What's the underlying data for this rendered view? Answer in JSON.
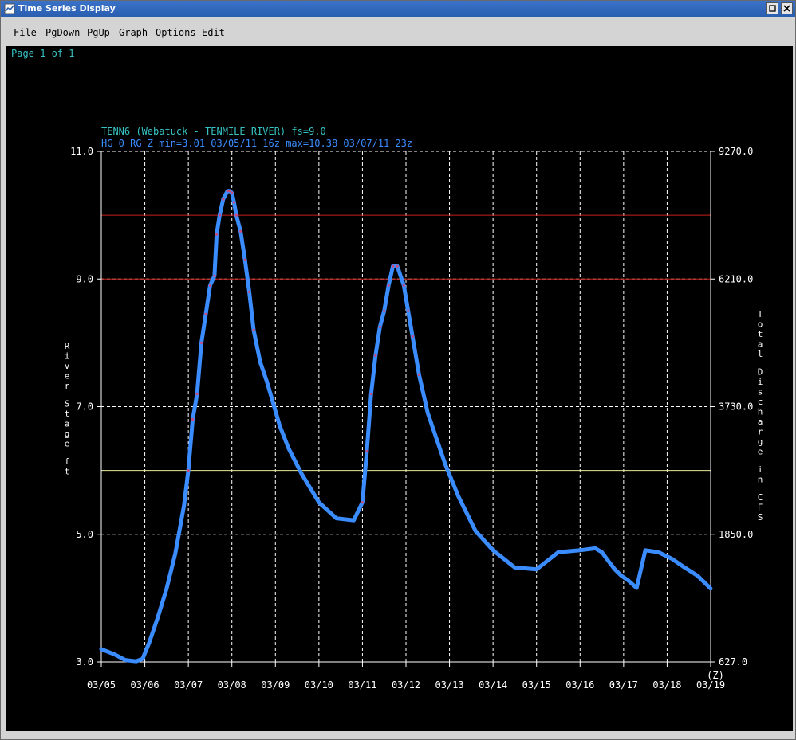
{
  "window": {
    "title": "Time Series Display"
  },
  "menu": {
    "items": [
      "File",
      "PgDown",
      "PgUp",
      "Graph",
      "Options",
      "Edit"
    ]
  },
  "page": {
    "label": "Page 1 of 1"
  },
  "colors": {
    "accent": "#3a8cff",
    "line_cyan": "#36c2c2",
    "grid": "#ffffff",
    "flood": "#c8201e",
    "action": "#e8e89a",
    "marker": "#c84a7a",
    "background": "#000000"
  },
  "icons": {
    "minimize": "minimize-icon",
    "close": "close-icon"
  },
  "chart_data": {
    "type": "line",
    "title": "TENN6 (Webatuck - TENMILE RIVER) fs=9.0",
    "subtitle": "HG 0 RG Z min=3.01 03/05/11 16z max=10.38 03/07/11 23z",
    "ylabel": "River Stage ft",
    "y2label": "Total Discharge in CFS",
    "ylim": [
      3.0,
      11.0
    ],
    "y_ticks": [
      "3.0",
      "5.0",
      "7.0",
      "9.0",
      "11.0"
    ],
    "y2_ticks": [
      "627.0",
      "1850.0",
      "3730.0",
      "6210.0",
      "9270.0"
    ],
    "x_ticks": [
      "03/05",
      "03/06",
      "03/07",
      "03/08",
      "03/09",
      "03/10",
      "03/11",
      "03/12",
      "03/13",
      "03/14",
      "03/15",
      "03/16",
      "03/17",
      "03/18",
      "03/19"
    ],
    "x_unit": "(Z)",
    "grid": true,
    "thresholds": [
      {
        "value": 10.0,
        "color": "#c8201e"
      },
      {
        "value": 9.0,
        "color": "#c8201e"
      },
      {
        "value": 6.0,
        "color": "#e8e89a"
      }
    ],
    "series": [
      {
        "x": [
          0,
          0.3,
          0.55,
          0.8,
          0.95,
          1.1,
          1.3,
          1.5,
          1.7,
          1.9,
          2.0,
          2.1,
          2.2,
          2.3,
          2.4,
          2.5,
          2.6,
          2.65,
          2.72,
          2.8,
          2.9,
          2.95,
          3.0,
          3.05,
          3.1,
          3.2,
          3.3,
          3.4,
          3.5,
          3.65,
          3.8,
          3.95,
          4.1,
          4.3,
          4.6,
          5.0,
          5.4,
          5.8,
          6.0,
          6.1,
          6.2,
          6.3,
          6.4,
          6.5,
          6.6,
          6.7,
          6.8,
          6.95,
          7.05,
          7.15,
          7.3,
          7.5,
          7.7,
          7.9,
          8.2,
          8.6,
          9.0,
          9.5,
          10.0,
          10.5,
          11.0,
          11.35,
          11.5,
          11.65,
          11.8,
          11.95,
          12.1,
          12.3,
          12.5,
          12.8,
          13.1,
          13.4,
          13.7,
          14.0
        ],
        "y": [
          3.2,
          3.12,
          3.03,
          3.01,
          3.05,
          3.3,
          3.7,
          4.15,
          4.7,
          5.45,
          6.0,
          6.8,
          7.2,
          8.0,
          8.45,
          8.9,
          9.05,
          9.7,
          10.0,
          10.25,
          10.38,
          10.38,
          10.35,
          10.2,
          10.0,
          9.75,
          9.3,
          8.8,
          8.2,
          7.7,
          7.4,
          7.05,
          6.7,
          6.35,
          5.95,
          5.5,
          5.25,
          5.22,
          5.5,
          6.3,
          7.2,
          7.8,
          8.25,
          8.5,
          8.9,
          9.2,
          9.2,
          8.9,
          8.5,
          8.1,
          7.5,
          6.9,
          6.5,
          6.1,
          5.6,
          5.05,
          4.75,
          4.48,
          4.45,
          4.72,
          4.75,
          4.78,
          4.72,
          4.58,
          4.45,
          4.35,
          4.28,
          4.16,
          4.75,
          4.72,
          4.62,
          4.48,
          4.35,
          4.15
        ]
      }
    ]
  }
}
